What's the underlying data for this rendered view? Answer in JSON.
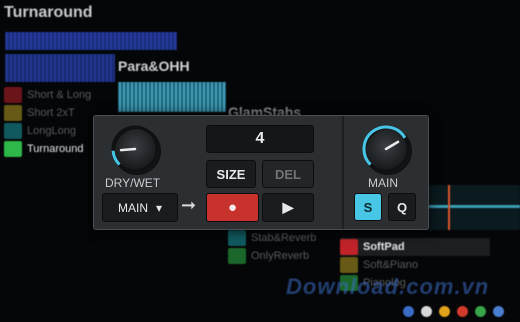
{
  "background": {
    "deck_title": "Turnaround",
    "clips": [
      {
        "label": "Para&OHH"
      },
      {
        "label": "GlamStabs"
      }
    ],
    "left_slots": [
      {
        "label": "Short & Long",
        "color": "#c0232a"
      },
      {
        "label": "Short 2xT",
        "color": "#b9a126"
      },
      {
        "label": "LongLong",
        "color": "#1aa0a8"
      },
      {
        "label": "Turnaround",
        "color": "#2fb84a"
      }
    ],
    "lower_slots": [
      {
        "label": "Stab&Reverb",
        "color": "#1aa0a8"
      },
      {
        "label": "OnlyReverb",
        "color": "#2fb84a"
      }
    ],
    "right_slots": [
      {
        "label": "SoftPad",
        "color": "#c0232a"
      },
      {
        "label": "Soft&Piano",
        "color": "#b9a126"
      },
      {
        "label": "Pianolog",
        "color": "#2fb84a"
      }
    ],
    "watermark": "Download.com.vn"
  },
  "panel": {
    "dry_wet_label": "DRY/WET",
    "dry_wet_level": 0.15,
    "size_value": "4",
    "size_label": "SIZE",
    "del_label": "DEL",
    "main_select_label": "MAIN",
    "main_knob_label": "MAIN",
    "main_knob_level": 0.72,
    "s_label": "S",
    "q_label": "Q",
    "arrow_glyph": "➞",
    "record_glyph": "●",
    "play_glyph": "▶",
    "dropdown_glyph": "▾"
  },
  "colors": {
    "accent_cyan": "#47c6e6",
    "record_red": "#c8322c"
  }
}
